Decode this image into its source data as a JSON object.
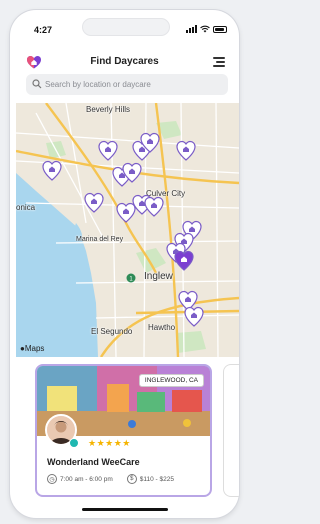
{
  "status_bar": {
    "time": "4:27"
  },
  "header": {
    "title": "Find Daycares",
    "logo_icon": "heart-house-icon",
    "menu_icon": "hamburger-menu-icon"
  },
  "search": {
    "placeholder": "Search by location or daycare",
    "value": ""
  },
  "map": {
    "labels": {
      "beverly_hills": "Beverly Hills",
      "culver_city": "Culver City",
      "santa_monica": "onica",
      "marina_del_rey": "Marina del Rey",
      "inglewood": "Inglew",
      "el_segundo": "El Segundo",
      "hawthorne": "Hawtho"
    },
    "attribution": "Maps",
    "pin_icon": "daycare-heart-pin-icon",
    "colors": {
      "pin_outline": "#7a5cc7",
      "pin_fill": "#ffffff",
      "pin_selected": "#7b3fd1",
      "water": "#a9d6ee",
      "park": "#cfe7c2",
      "highway": "#f5c451"
    }
  },
  "card": {
    "location_badge": "INGLEWOOD, CA",
    "rating_stars": "★★★★★",
    "rating": 5,
    "name": "Wonderland WeeCare",
    "hours": "7:00 am - 6:00 pm",
    "price": "$110 - $225",
    "colors": {
      "border": "#b9a6e6",
      "stars": "#f5b400",
      "verified": "#1fb7b0"
    }
  }
}
